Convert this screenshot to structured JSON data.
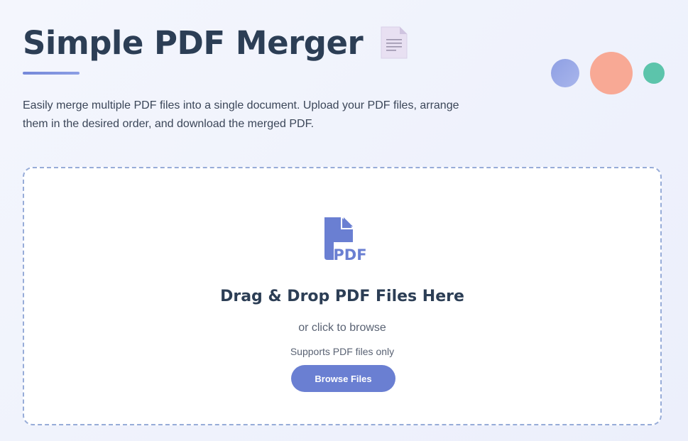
{
  "header": {
    "title": "Simple PDF Merger",
    "title_icon": "document-icon",
    "description": "Easily merge multiple PDF files into a single document. Upload your PDF files, arrange them in the desired order, and download the merged PDF."
  },
  "decorations": {
    "dots": [
      {
        "name": "blue-dot",
        "color": "#9aa9e8"
      },
      {
        "name": "coral-dot",
        "color": "#f8a995"
      },
      {
        "name": "teal-dot",
        "color": "#5cc4ab"
      }
    ]
  },
  "upload": {
    "icon": "pdf-file-icon",
    "icon_text": "PDF",
    "heading": "Drag & Drop PDF Files Here",
    "subheading": "or click to browse",
    "note": "Supports PDF files only",
    "button_label": "Browse Files"
  },
  "colors": {
    "title": "#2c3e55",
    "accent": "#6a7fd2",
    "drop_border": "#97acd8"
  }
}
